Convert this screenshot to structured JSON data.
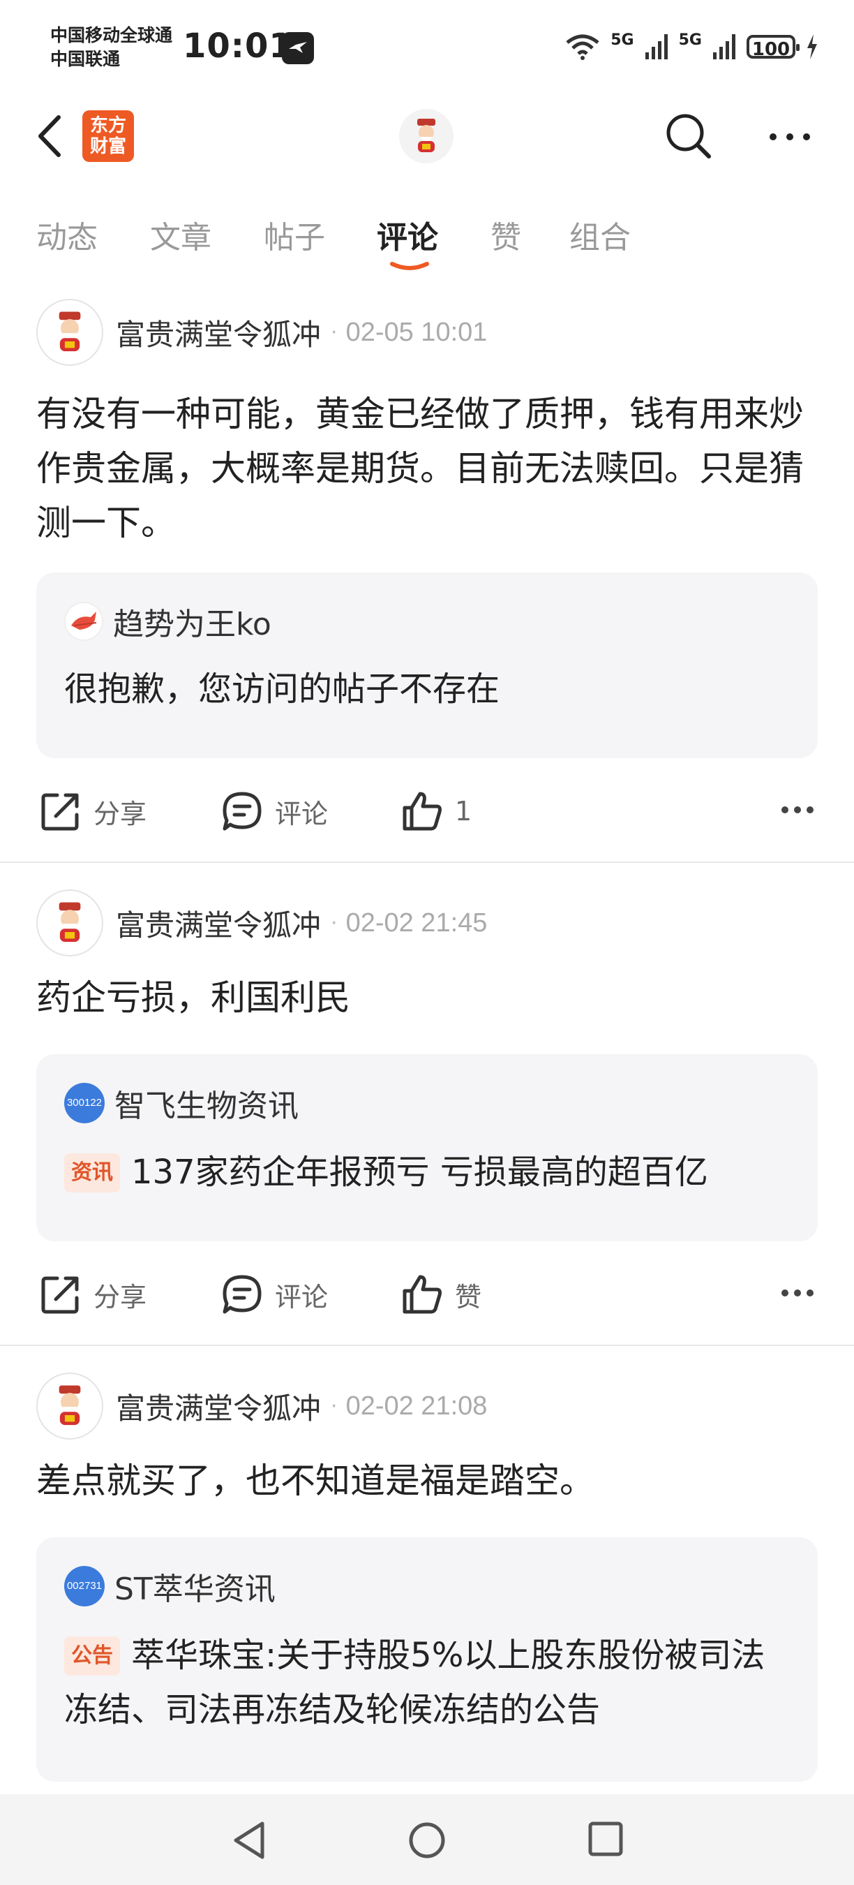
{
  "status_bar": {
    "carrier_line1": "中国移动全球通",
    "carrier_line2": "中国联通",
    "time": "10:01",
    "network1": "5G",
    "network2": "5G",
    "battery": "100"
  },
  "header": {
    "logo_text_line1": "东方",
    "logo_text_line2": "财富"
  },
  "tabs": [
    {
      "label": "动态"
    },
    {
      "label": "文章"
    },
    {
      "label": "帖子"
    },
    {
      "label": "评论",
      "active": true
    },
    {
      "label": "赞"
    },
    {
      "label": "组合"
    }
  ],
  "posts": [
    {
      "author": "富贵满堂令狐冲",
      "time": "02-05 10:01",
      "content": "有没有一种可能，黄金已经做了质押，钱有用来炒作贵金属，大概率是期货。目前无法赎回。只是猜测一下。",
      "quote": {
        "name": "趋势为王ko",
        "body": "很抱歉，您访问的帖子不存在"
      },
      "share_label": "分享",
      "comment_label": "评论",
      "like_label": "1"
    },
    {
      "author": "富贵满堂令狐冲",
      "time": "02-02 21:45",
      "content": "药企亏损，利国利民",
      "quote": {
        "badge": "300122",
        "name": "智飞生物资讯",
        "tag": "资讯",
        "body": "137家药企年报预亏 亏损最高的超百亿"
      },
      "share_label": "分享",
      "comment_label": "评论",
      "like_label": "赞"
    },
    {
      "author": "富贵满堂令狐冲",
      "time": "02-02 21:08",
      "content": "差点就买了，也不知道是福是踏空。",
      "quote": {
        "badge": "002731",
        "name": "ST萃华资讯",
        "tag": "公告",
        "body": "萃华珠宝:关于持股5%以上股东股份被司法冻结、司法再冻结及轮候冻结的公告"
      }
    }
  ],
  "colors": {
    "accent": "#ee5a24",
    "tag_text": "#e0562a",
    "tag_bg": "#fde8df",
    "stock_badge": "#3b7bdc"
  }
}
